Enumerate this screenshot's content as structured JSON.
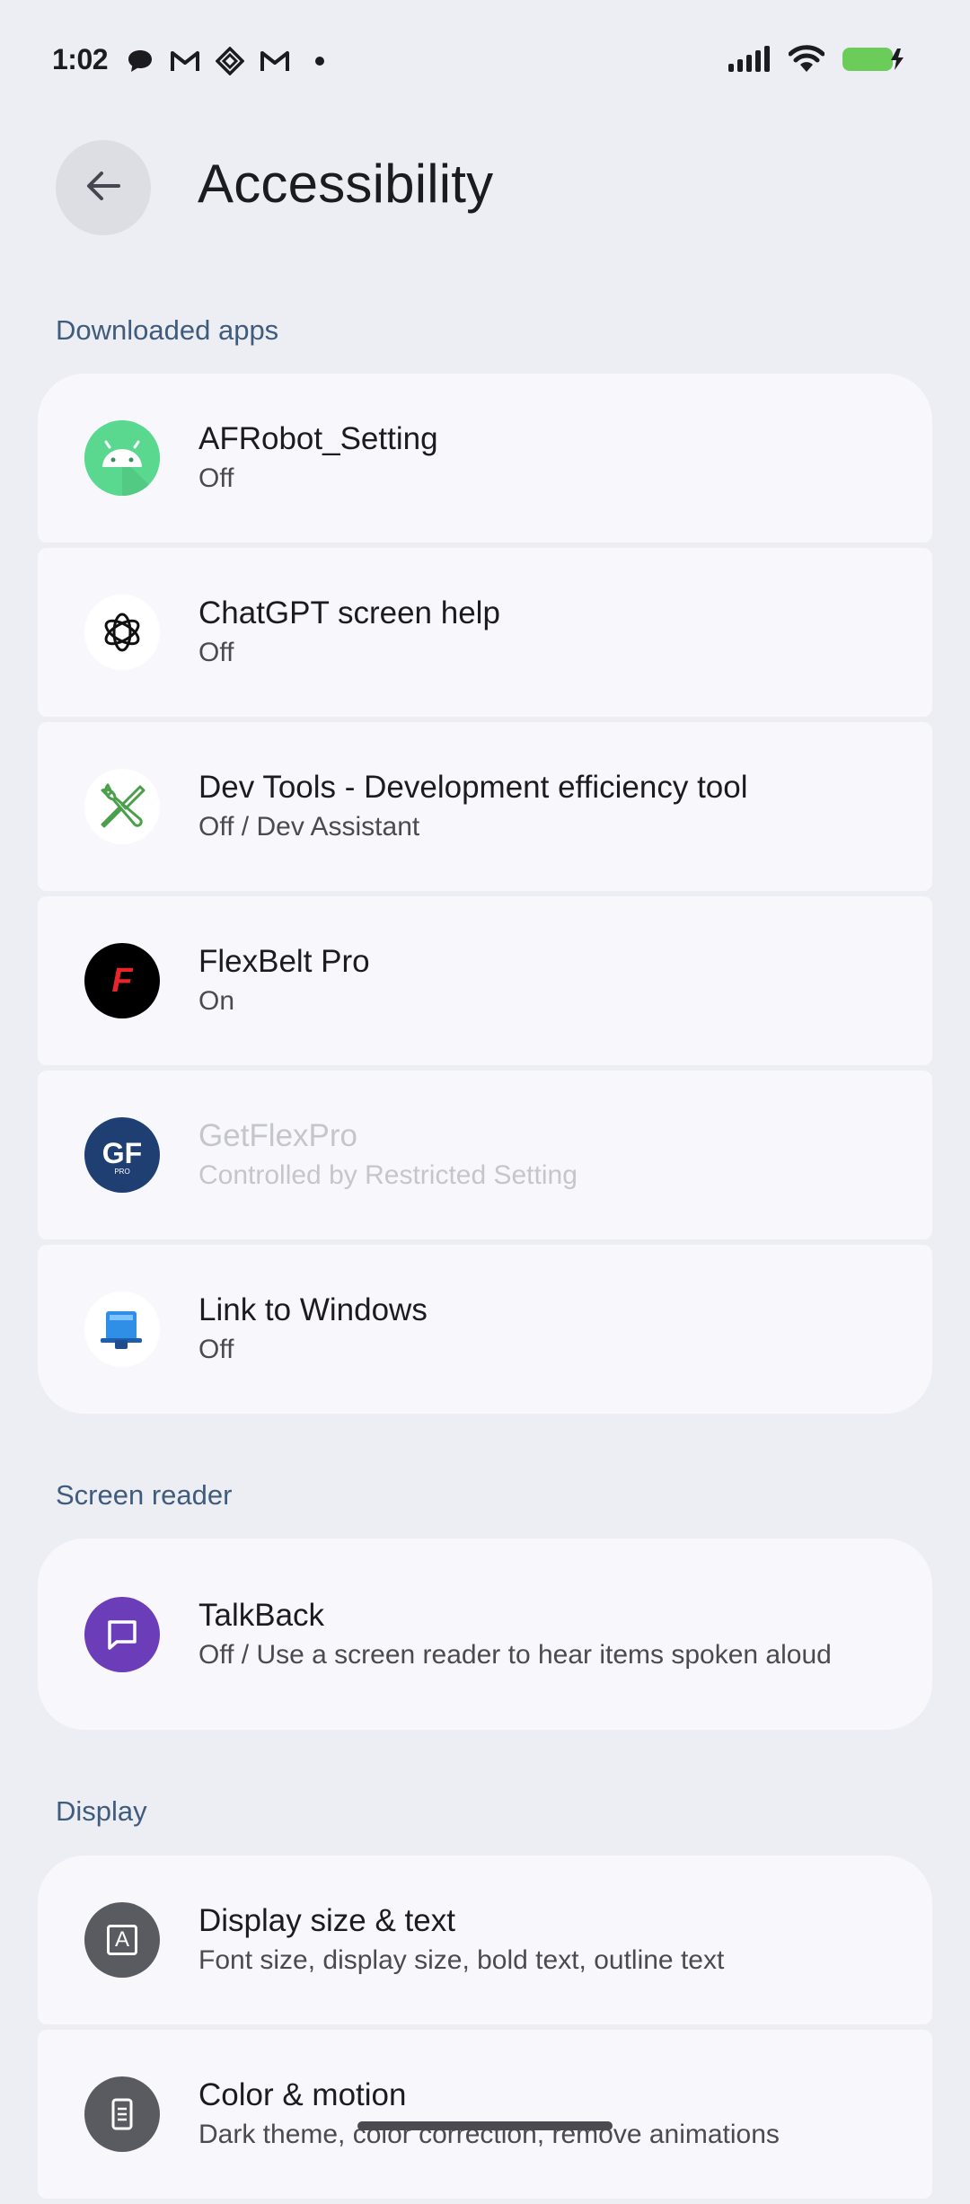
{
  "status_bar": {
    "time": "1:02",
    "notification_icons": [
      "chat-bubble-icon",
      "gmail-icon",
      "diamond-app-icon",
      "gmail-icon",
      "dot-icon"
    ],
    "system_icons": [
      "signal-icon",
      "wifi-icon",
      "battery-charging-icon"
    ],
    "battery_color": "#6ccc5a"
  },
  "header": {
    "title": "Accessibility"
  },
  "sections": {
    "downloaded": {
      "label": "Downloaded apps",
      "items": [
        {
          "title": "AFRobot_Setting",
          "subtitle": "Off",
          "icon": "android-icon",
          "enabled": true
        },
        {
          "title": "ChatGPT screen help",
          "subtitle": "Off",
          "icon": "chatgpt-icon",
          "enabled": true
        },
        {
          "title": "Dev Tools - Development efficiency tool",
          "subtitle": "Off / Dev Assistant",
          "icon": "wrench-screwdriver-icon",
          "enabled": true
        },
        {
          "title": "FlexBelt Pro",
          "subtitle": "On",
          "icon": "flexbelt-icon",
          "icon_letter": "F",
          "enabled": true
        },
        {
          "title": "GetFlexPro",
          "subtitle": "Controlled by Restricted Setting",
          "icon": "getflexpro-icon",
          "icon_letter": "GF",
          "icon_sub": "PRO",
          "enabled": false
        },
        {
          "title": "Link to Windows",
          "subtitle": "Off",
          "icon": "link-to-windows-icon",
          "enabled": true
        }
      ]
    },
    "screen_reader": {
      "label": "Screen reader",
      "items": [
        {
          "title": "TalkBack",
          "subtitle": "Off / Use a screen reader to hear items spoken aloud",
          "icon": "talkback-icon",
          "enabled": true
        }
      ]
    },
    "display": {
      "label": "Display",
      "items": [
        {
          "title": "Display size & text",
          "subtitle": "Font size, display size, bold text, outline text",
          "icon": "display-size-icon",
          "icon_letter": "A",
          "enabled": true
        },
        {
          "title": "Color & motion",
          "subtitle": "Dark theme, color correction, remove animations",
          "icon": "color-motion-icon",
          "enabled": true
        }
      ]
    }
  }
}
